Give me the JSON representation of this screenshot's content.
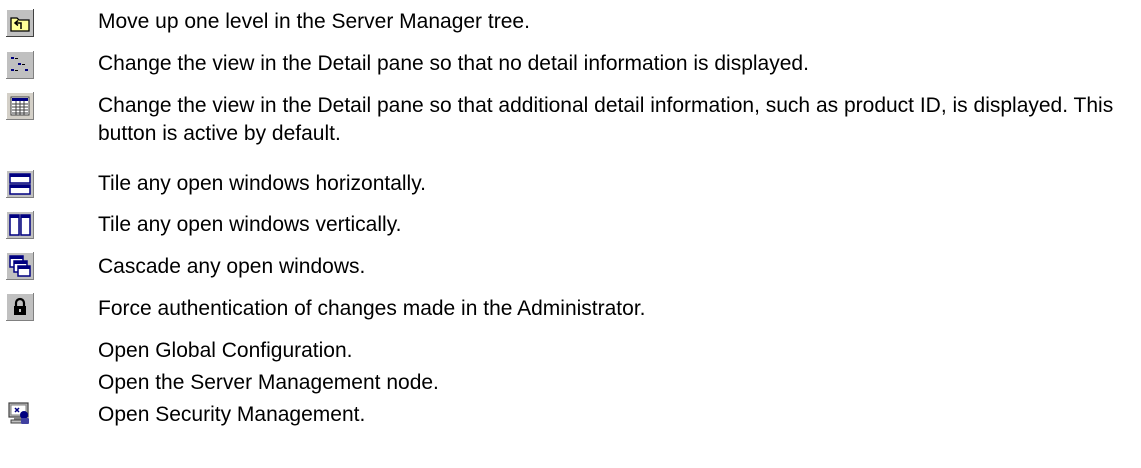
{
  "toolbar_help": {
    "items": [
      {
        "icon": "up-one-level-icon",
        "text": "Move up one level in the Server Manager tree."
      },
      {
        "icon": "no-detail-view-icon",
        "text": "Change the view in the Detail pane so that no detail information is displayed."
      },
      {
        "icon": "detail-view-icon",
        "text": "Change the view in the Detail pane so that additional detail information, such as product ID, is displayed. This button is active by default."
      },
      {
        "icon": "tile-horizontal-icon",
        "text": "Tile any open windows horizontally."
      },
      {
        "icon": "tile-vertical-icon",
        "text": "Tile any open windows vertically."
      },
      {
        "icon": "cascade-windows-icon",
        "text": "Cascade any open windows."
      },
      {
        "icon": "lock-icon",
        "text": "Force authentication of changes made in the Administrator."
      },
      {
        "icon": "",
        "text": "Open Global Configuration."
      },
      {
        "icon": "",
        "text": "Open the Server Management node."
      },
      {
        "icon": "security-management-icon",
        "text": "Open Security Management."
      }
    ]
  },
  "colors": {
    "icon_face": "#c0c0c0",
    "icon_highlight": "#ffffff",
    "icon_shadow": "#808080",
    "icon_dark": "#000000",
    "icon_blue": "#000080",
    "folder_yellow": "#ffff99"
  }
}
